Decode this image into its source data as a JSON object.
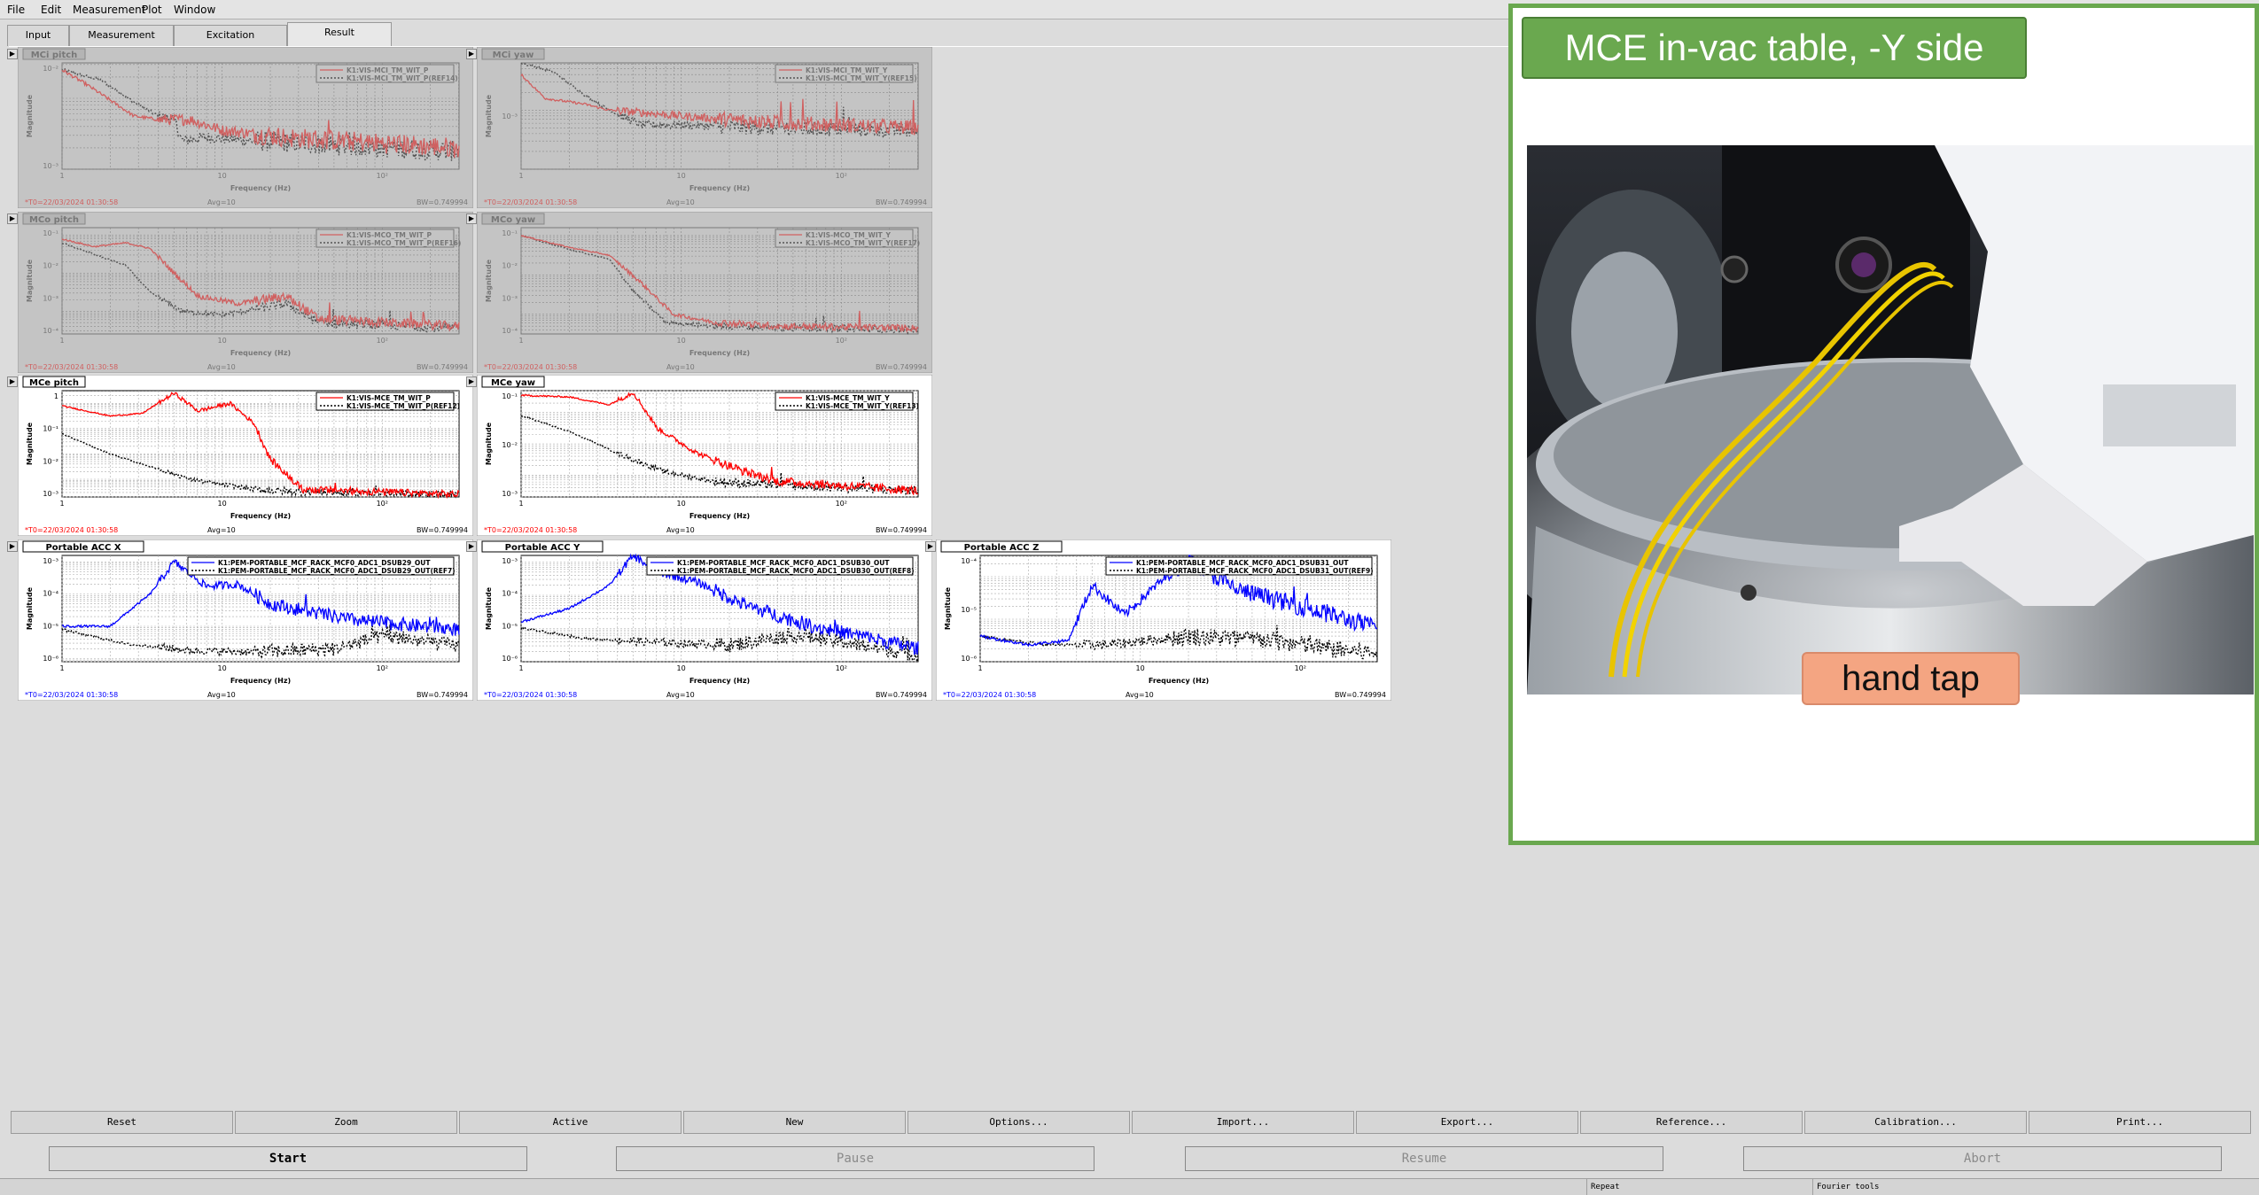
{
  "menu": [
    {
      "name": "menu-file",
      "label": "File"
    },
    {
      "name": "menu-edit",
      "label": "Edit"
    },
    {
      "name": "menu-measurement",
      "label": "Measurement"
    },
    {
      "name": "menu-plot",
      "label": "Plot"
    },
    {
      "name": "menu-window",
      "label": "Window"
    }
  ],
  "tabs": [
    {
      "label": "Input",
      "active": false
    },
    {
      "label": "Measurement",
      "active": false
    },
    {
      "label": "Excitation",
      "active": false
    },
    {
      "label": "Result",
      "active": true
    }
  ],
  "photo": {
    "title": "MCE in-vac table, -Y side",
    "label": "hand tap"
  },
  "plot_common": {
    "xlabel": "Frequency (Hz)",
    "ylabel": "Magnitude",
    "avg": "Avg=10",
    "bw": "BW=0.749994",
    "t0": "*T0=22/03/2024 01:30:58"
  },
  "panels": [
    {
      "id": "mci-pitch",
      "title": "MCi pitch",
      "state": "inactive",
      "row": 0,
      "col": 0,
      "legend": [
        "K1:VIS-MCI_TM_WIT_P",
        "K1:VIS-MCI_TM_WIT_P(REF14)"
      ],
      "yticks": [
        "10⁻²",
        "10⁻³"
      ],
      "xticks": [
        "1",
        "10",
        "10²"
      ],
      "curve": "mci_p"
    },
    {
      "id": "mci-yaw",
      "title": "MCi yaw",
      "state": "inactive",
      "row": 0,
      "col": 1,
      "legend": [
        "K1:VIS-MCI_TM_WIT_Y",
        "K1:VIS-MCI_TM_WIT_Y(REF15)"
      ],
      "yticks": [
        "10⁻³"
      ],
      "xticks": [
        "1",
        "10",
        "10²"
      ],
      "curve": "mci_y"
    },
    {
      "id": "mco-pitch",
      "title": "MCo pitch",
      "state": "inactive",
      "row": 1,
      "col": 0,
      "legend": [
        "K1:VIS-MCO_TM_WIT_P",
        "K1:VIS-MCO_TM_WIT_P(REF16)"
      ],
      "yticks": [
        "10⁻¹",
        "10⁻²",
        "10⁻³",
        "10⁻⁴"
      ],
      "xticks": [
        "1",
        "10",
        "10²"
      ],
      "curve": "mco_p"
    },
    {
      "id": "mco-yaw",
      "title": "MCo yaw",
      "state": "inactive",
      "row": 1,
      "col": 1,
      "legend": [
        "K1:VIS-MCO_TM_WIT_Y",
        "K1:VIS-MCO_TM_WIT_Y(REF17)"
      ],
      "yticks": [
        "10⁻¹",
        "10⁻²",
        "10⁻³",
        "10⁻⁴"
      ],
      "xticks": [
        "1",
        "10",
        "10²"
      ],
      "curve": "mco_y"
    },
    {
      "id": "mce-pitch",
      "title": "MCe pitch",
      "state": "active",
      "row": 2,
      "col": 0,
      "color": "#ff0000",
      "legend": [
        "K1:VIS-MCE_TM_WIT_P",
        "K1:VIS-MCE_TM_WIT_P(REF12)"
      ],
      "yticks": [
        "1",
        "10⁻¹",
        "10⁻²",
        "10⁻³"
      ],
      "xticks": [
        "1",
        "10",
        "10²"
      ],
      "curve": "mce_p"
    },
    {
      "id": "mce-yaw",
      "title": "MCe yaw",
      "state": "active",
      "row": 2,
      "col": 1,
      "color": "#ff0000",
      "legend": [
        "K1:VIS-MCE_TM_WIT_Y",
        "K1:VIS-MCE_TM_WIT_Y(REF13)"
      ],
      "yticks": [
        "10⁻¹",
        "10⁻²",
        "10⁻³"
      ],
      "xticks": [
        "1",
        "10",
        "10²"
      ],
      "curve": "mce_y"
    },
    {
      "id": "acc-x",
      "title": "Portable ACC X",
      "state": "active",
      "row": 3,
      "col": 0,
      "color": "#0000ff",
      "legend": [
        "K1:PEM-PORTABLE_MCF_RACK_MCF0_ADC1_DSUB29_OUT",
        "K1:PEM-PORTABLE_MCF_RACK_MCF0_ADC1_DSUB29_OUT(REF7)"
      ],
      "yticks": [
        "10⁻³",
        "10⁻⁴",
        "10⁻⁵",
        "10⁻⁶"
      ],
      "xticks": [
        "1",
        "10",
        "10²"
      ],
      "curve": "acc_x"
    },
    {
      "id": "acc-y",
      "title": "Portable ACC Y",
      "state": "active",
      "row": 3,
      "col": 1,
      "color": "#0000ff",
      "legend": [
        "K1:PEM-PORTABLE_MCF_RACK_MCF0_ADC1_DSUB30_OUT",
        "K1:PEM-PORTABLE_MCF_RACK_MCF0_ADC1_DSUB30_OUT(REF8)"
      ],
      "yticks": [
        "10⁻³",
        "10⁻⁴",
        "10⁻⁵",
        "10⁻⁶"
      ],
      "xticks": [
        "1",
        "10",
        "10²"
      ],
      "curve": "acc_y"
    },
    {
      "id": "acc-z",
      "title": "Portable ACC Z",
      "state": "active",
      "row": 3,
      "col": 2,
      "color": "#0000ff",
      "legend": [
        "K1:PEM-PORTABLE_MCF_RACK_MCF0_ADC1_DSUB31_OUT",
        "K1:PEM-PORTABLE_MCF_RACK_MCF0_ADC1_DSUB31_OUT(REF9)"
      ],
      "yticks": [
        "10⁻⁴",
        "10⁻⁵",
        "10⁻⁶"
      ],
      "xticks": [
        "1",
        "10",
        "10²"
      ],
      "curve": "acc_z"
    }
  ],
  "buttons_row1": [
    "Reset",
    "Zoom",
    "Active",
    "New",
    "Options...",
    "Import...",
    "Export...",
    "Reference...",
    "Calibration...",
    "Print..."
  ],
  "buttons_row2": [
    {
      "label": "Start",
      "enabled": true
    },
    {
      "label": "Pause",
      "enabled": false
    },
    {
      "label": "Resume",
      "enabled": false
    },
    {
      "label": "Abort",
      "enabled": false
    }
  ],
  "status": [
    "Repeat",
    "Fourier tools"
  ],
  "colors": {
    "inactive_trace": "#d06060",
    "active_red": "#ff0000",
    "active_blue": "#0000ff",
    "ref_trace": "#000000",
    "photo_border": "#6aa84f",
    "label_bg": "#f4a582"
  }
}
